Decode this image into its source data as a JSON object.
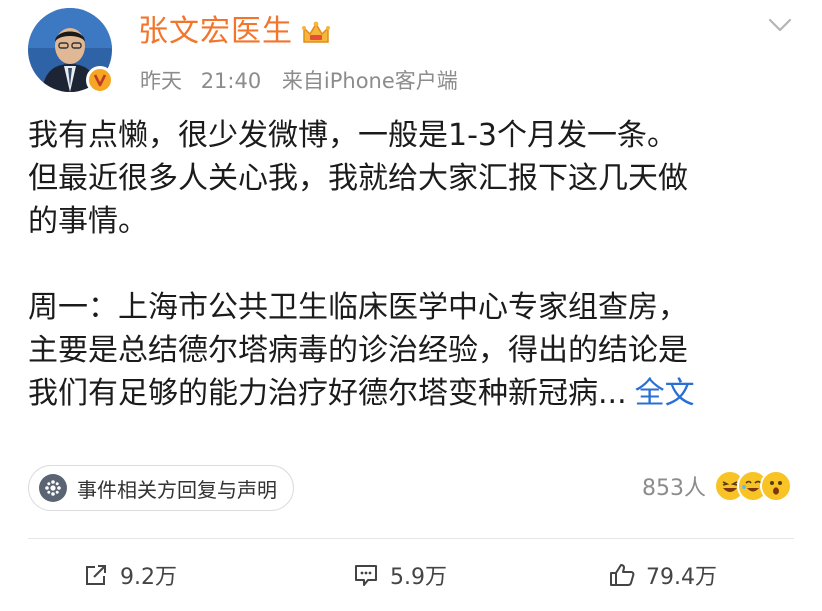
{
  "author": {
    "name": "张文宏医生"
  },
  "meta": {
    "day": "昨天",
    "time": "21:40",
    "source": "来自iPhone客户端"
  },
  "content": {
    "lines_p1": [
      "我有点懒，很少发微博，一般是1-3个月发一条。",
      "但最近很多人关心我，我就给大家汇报下这几天做",
      "的事情。"
    ],
    "lines_p2": [
      "周一：上海市公共卫生临床医学中心专家组查房，",
      "主要是总结德尔塔病毒的诊治经验，得出的结论是",
      "我们有足够的能力治疗好德尔塔变种新冠病..."
    ],
    "more_label": "全文"
  },
  "event": {
    "label": "事件相关方回复与声明"
  },
  "reactions": {
    "count": "853人"
  },
  "actions": {
    "repost": "9.2万",
    "comment": "5.9万",
    "like": "79.4万"
  },
  "colors": {
    "author_name": "#f2752b",
    "link": "#2a6fd6",
    "meta": "#8c8c8c",
    "verified_badge": "#f5a623"
  },
  "icons": [
    "crown-icon",
    "chevron-down-icon",
    "verified-badge-icon",
    "event-icon",
    "laugh-emoji-icon",
    "repost-icon",
    "comment-icon",
    "like-icon"
  ]
}
